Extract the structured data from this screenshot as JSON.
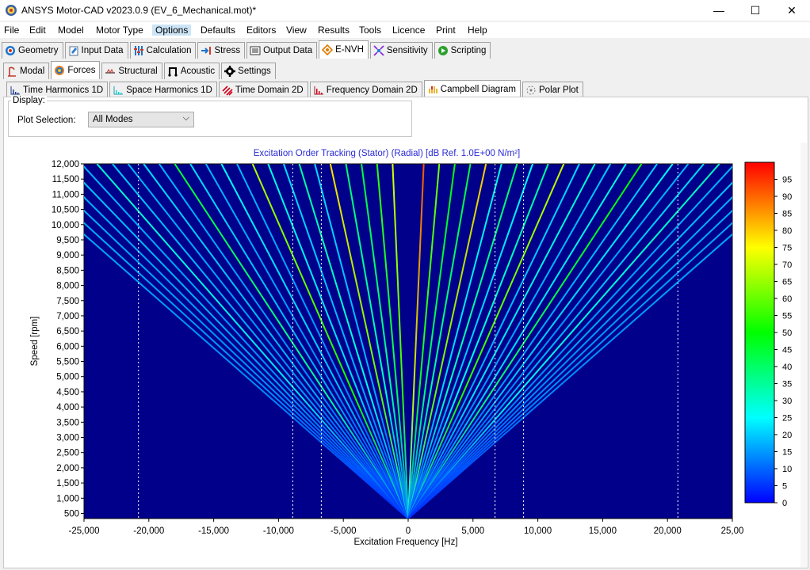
{
  "window": {
    "title": "ANSYS Motor-CAD v2023.0.9 (EV_6_Mechanical.mot)*",
    "minimize": "—",
    "maximize": "☐",
    "close": "✕"
  },
  "menu": [
    "File",
    "Edit",
    "Model",
    "Motor Type",
    "Options",
    "Defaults",
    "Editors",
    "View",
    "Results",
    "Tools",
    "Licence",
    "Print",
    "Help"
  ],
  "main_tabs": [
    "Geometry",
    "Input Data",
    "Calculation",
    "Stress",
    "Output Data",
    "E-NVH",
    "Sensitivity",
    "Scripting"
  ],
  "main_tab_selected": "E-NVH",
  "sub_tabs": [
    "Modal",
    "Forces",
    "Structural",
    "Acoustic",
    "Settings"
  ],
  "sub_tab_selected": "Forces",
  "plot_tabs": [
    "Time Harmonics 1D",
    "Space Harmonics 1D",
    "Time Domain 2D",
    "Frequency Domain 2D",
    "Campbell Diagram",
    "Polar Plot"
  ],
  "plot_tab_selected": "Campbell Diagram",
  "display": {
    "legend": "Display:",
    "plot_selection_label": "Plot Selection:",
    "plot_selection_value": "All Modes"
  },
  "chart_data": {
    "type": "line",
    "title": "Excitation Order Tracking (Stator) (Radial) [dB Ref. 1.0E+00 N/m²]",
    "xlabel": "Excitation Frequency [Hz]",
    "ylabel": "Speed [rpm]",
    "xlim": [
      -25000,
      25000
    ],
    "ylim": [
      0,
      12000
    ],
    "x_ticks": [
      "-25,000",
      "-20,000",
      "-15,000",
      "-10,000",
      "-5,000",
      "0",
      "5,000",
      "10,000",
      "15,000",
      "20,000",
      "25,00"
    ],
    "y_ticks": [
      "500",
      "1,000",
      "1,500",
      "2,000",
      "2,500",
      "3,000",
      "3,500",
      "4,000",
      "4,500",
      "5,000",
      "5,500",
      "6,000",
      "6,500",
      "7,000",
      "7,500",
      "8,000",
      "8,500",
      "9,000",
      "9,500",
      "10,000",
      "10,500",
      "11,000",
      "11,500",
      "12,000"
    ],
    "background_color": "#00008b",
    "colorbar": {
      "min": 0,
      "max": 100,
      "ticks": [
        "95",
        "90",
        "85",
        "80",
        "75",
        "70",
        "65",
        "60",
        "55",
        "50",
        "45",
        "40",
        "35",
        "30",
        "25",
        "20",
        "15",
        "10",
        "5",
        "0"
      ],
      "colors": [
        "#0000ff",
        "#00ffff",
        "#00ff00",
        "#ffff00",
        "#ff0000"
      ]
    },
    "vertical_markers_hz": [
      -20800,
      -8900,
      -6700,
      6700,
      8900,
      20800
    ],
    "order_line_step_hz_at_12000rpm": 1200,
    "order_lines": [
      {
        "freq_at_12000rpm": -31200,
        "level_db": 18
      },
      {
        "freq_at_12000rpm": -30000,
        "level_db": 18
      },
      {
        "freq_at_12000rpm": -28800,
        "level_db": 18
      },
      {
        "freq_at_12000rpm": -27600,
        "level_db": 18
      },
      {
        "freq_at_12000rpm": -26400,
        "level_db": 20
      },
      {
        "freq_at_12000rpm": -25200,
        "level_db": 18
      },
      {
        "freq_at_12000rpm": -24000,
        "level_db": 30
      },
      {
        "freq_at_12000rpm": -22800,
        "level_db": 20
      },
      {
        "freq_at_12000rpm": -21600,
        "level_db": 18
      },
      {
        "freq_at_12000rpm": -20400,
        "level_db": 22
      },
      {
        "freq_at_12000rpm": -19200,
        "level_db": 18
      },
      {
        "freq_at_12000rpm": -18000,
        "level_db": 45
      },
      {
        "freq_at_12000rpm": -16800,
        "level_db": 22
      },
      {
        "freq_at_12000rpm": -15600,
        "level_db": 18
      },
      {
        "freq_at_12000rpm": -14400,
        "level_db": 25
      },
      {
        "freq_at_12000rpm": -13200,
        "level_db": 18
      },
      {
        "freq_at_12000rpm": -12000,
        "level_db": 68
      },
      {
        "freq_at_12000rpm": -10800,
        "level_db": 28
      },
      {
        "freq_at_12000rpm": -9600,
        "level_db": 22
      },
      {
        "freq_at_12000rpm": -8400,
        "level_db": 35
      },
      {
        "freq_at_12000rpm": -7200,
        "level_db": 22
      },
      {
        "freq_at_12000rpm": -6000,
        "level_db": 78
      },
      {
        "freq_at_12000rpm": -4800,
        "level_db": 40
      },
      {
        "freq_at_12000rpm": -3600,
        "level_db": 45
      },
      {
        "freq_at_12000rpm": -2400,
        "level_db": 55
      },
      {
        "freq_at_12000rpm": -1200,
        "level_db": 72
      },
      {
        "freq_at_12000rpm": 1200,
        "level_db": 92
      },
      {
        "freq_at_12000rpm": 2400,
        "level_db": 62
      },
      {
        "freq_at_12000rpm": 3600,
        "level_db": 50
      },
      {
        "freq_at_12000rpm": 4800,
        "level_db": 45
      },
      {
        "freq_at_12000rpm": 6000,
        "level_db": 80
      },
      {
        "freq_at_12000rpm": 7200,
        "level_db": 28
      },
      {
        "freq_at_12000rpm": 8400,
        "level_db": 40
      },
      {
        "freq_at_12000rpm": 9600,
        "level_db": 25
      },
      {
        "freq_at_12000rpm": 10800,
        "level_db": 35
      },
      {
        "freq_at_12000rpm": 12000,
        "level_db": 70
      },
      {
        "freq_at_12000rpm": 13200,
        "level_db": 22
      },
      {
        "freq_at_12000rpm": 14400,
        "level_db": 30
      },
      {
        "freq_at_12000rpm": 15600,
        "level_db": 20
      },
      {
        "freq_at_12000rpm": 16800,
        "level_db": 28
      },
      {
        "freq_at_12000rpm": 18000,
        "level_db": 50
      },
      {
        "freq_at_12000rpm": 19200,
        "level_db": 20
      },
      {
        "freq_at_12000rpm": 20400,
        "level_db": 25
      },
      {
        "freq_at_12000rpm": 21600,
        "level_db": 18
      },
      {
        "freq_at_12000rpm": 22800,
        "level_db": 22
      },
      {
        "freq_at_12000rpm": 24000,
        "level_db": 32
      },
      {
        "freq_at_12000rpm": 25200,
        "level_db": 18
      },
      {
        "freq_at_12000rpm": 26400,
        "level_db": 20
      },
      {
        "freq_at_12000rpm": 27600,
        "level_db": 18
      },
      {
        "freq_at_12000rpm": 28800,
        "level_db": 18
      },
      {
        "freq_at_12000rpm": 30000,
        "level_db": 18
      },
      {
        "freq_at_12000rpm": 31200,
        "level_db": 18
      }
    ]
  }
}
